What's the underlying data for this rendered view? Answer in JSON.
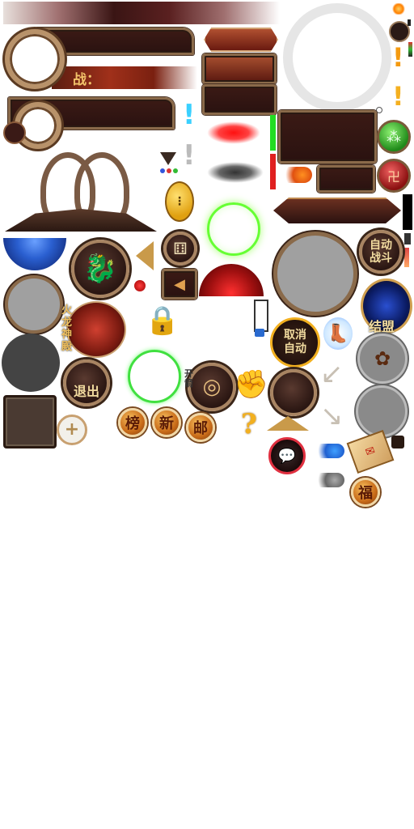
{
  "labels": {
    "battle_label": "战：",
    "auto_battle": "自动战斗",
    "cancel_auto": "取消自动",
    "exit": "退出",
    "alliance": "结盟",
    "rank": "榜",
    "new": "新",
    "mail": "邮",
    "fortune": "福",
    "question": "?",
    "exclaim": "!",
    "side_text": "火龙神殿",
    "arrow_text": "开箭"
  },
  "colors": {
    "red_glow": "#ff2020",
    "green_ring": "#66ff33",
    "blue_orb": "#2a5fd0",
    "gold": "#c9a26a",
    "dark_red": "#3a1512"
  },
  "icons": [
    "portrait-frame-icon",
    "bar-frame-icon",
    "double-ring-ornament-icon",
    "blue-orb-icon",
    "dragon-medallion-icon",
    "arrow-left-icon",
    "dice-icon",
    "red-dome-icon",
    "lock-chain-icon",
    "exclamation-icon",
    "chat-bubble-icon",
    "winged-boot-icon",
    "scroll-letter-icon",
    "hand-icon",
    "target-icon",
    "curved-arrow-icon",
    "chevron-down-icon",
    "plus-icon"
  ]
}
